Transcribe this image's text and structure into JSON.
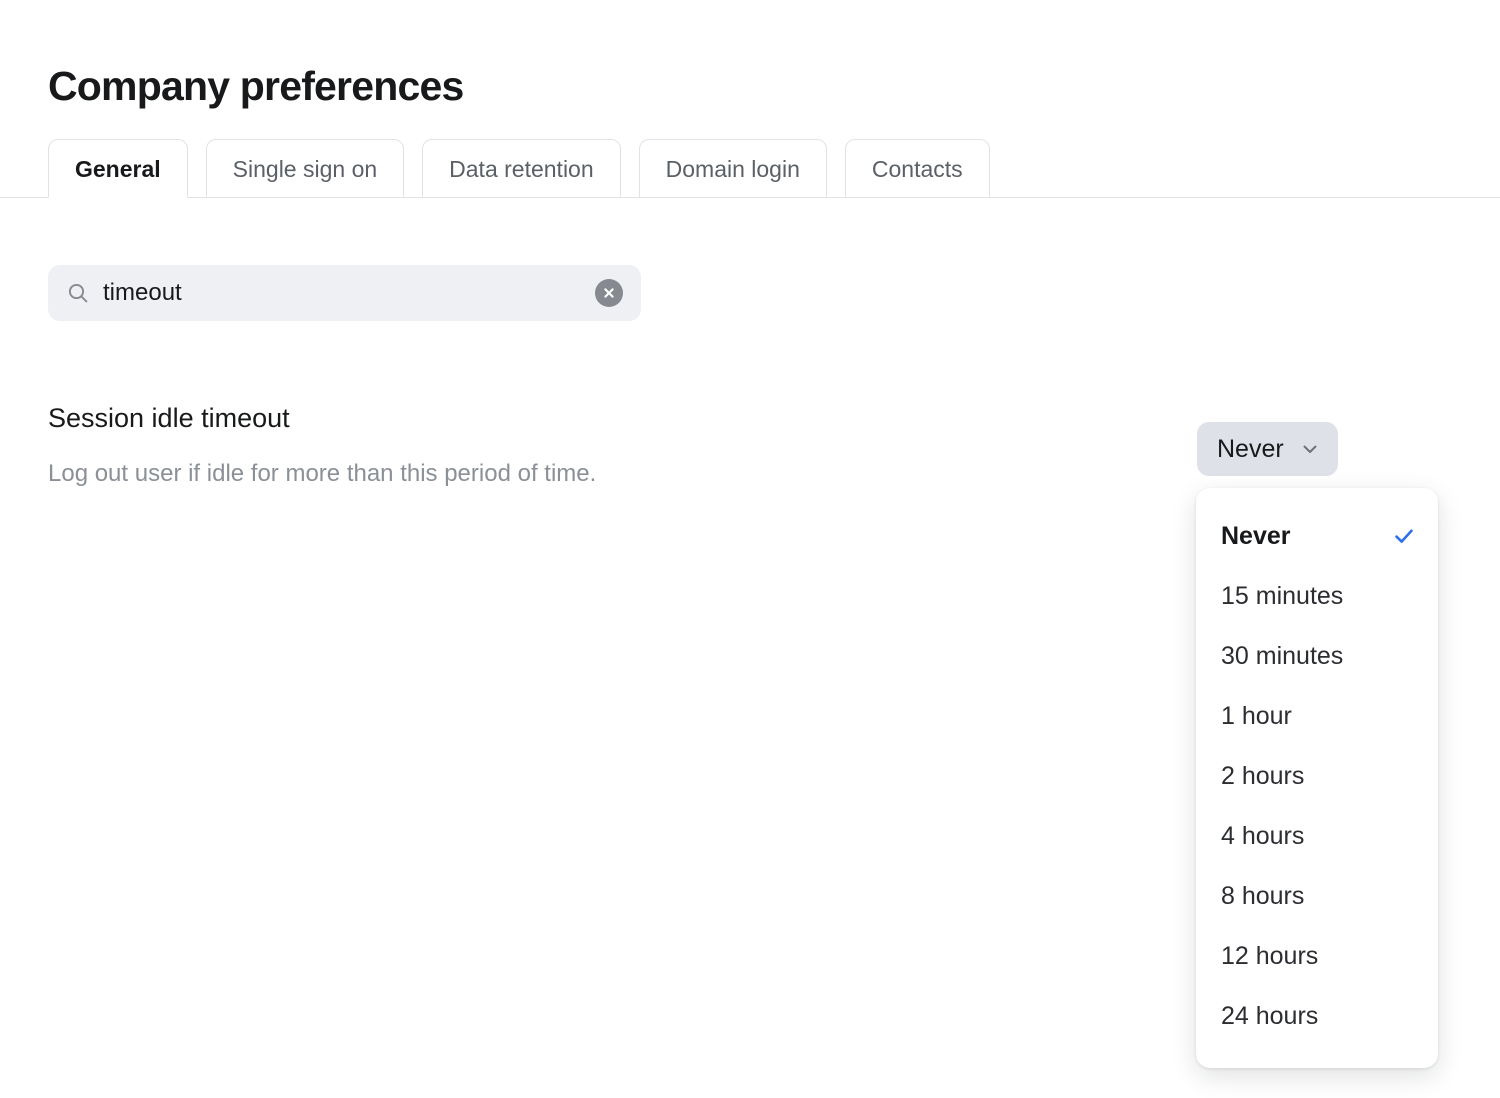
{
  "page": {
    "title": "Company preferences"
  },
  "tabs": [
    {
      "label": "General",
      "active": true
    },
    {
      "label": "Single sign on",
      "active": false
    },
    {
      "label": "Data retention",
      "active": false
    },
    {
      "label": "Domain login",
      "active": false
    },
    {
      "label": "Contacts",
      "active": false
    }
  ],
  "search": {
    "value": "timeout",
    "placeholder": "Search",
    "icon": "search-icon",
    "clear_icon": "clear-circle-icon"
  },
  "setting": {
    "label": "Session idle timeout",
    "description": "Log out user if idle for more than this period of time."
  },
  "select": {
    "value": "Never",
    "chevron_icon": "chevron-down-icon",
    "check_icon": "check-icon",
    "expanded": true,
    "options": [
      {
        "label": "Never",
        "selected": true
      },
      {
        "label": "15 minutes",
        "selected": false
      },
      {
        "label": "30 minutes",
        "selected": false
      },
      {
        "label": "1 hour",
        "selected": false
      },
      {
        "label": "2 hours",
        "selected": false
      },
      {
        "label": "4 hours",
        "selected": false
      },
      {
        "label": "8 hours",
        "selected": false
      },
      {
        "label": "12 hours",
        "selected": false
      },
      {
        "label": "24 hours",
        "selected": false
      }
    ]
  },
  "colors": {
    "accent": "#2f6fed",
    "text": "#18191b",
    "muted": "#8b9097",
    "field_bg": "#eff0f4",
    "trigger_bg": "#dee2e8",
    "border": "#dfe3e8"
  }
}
